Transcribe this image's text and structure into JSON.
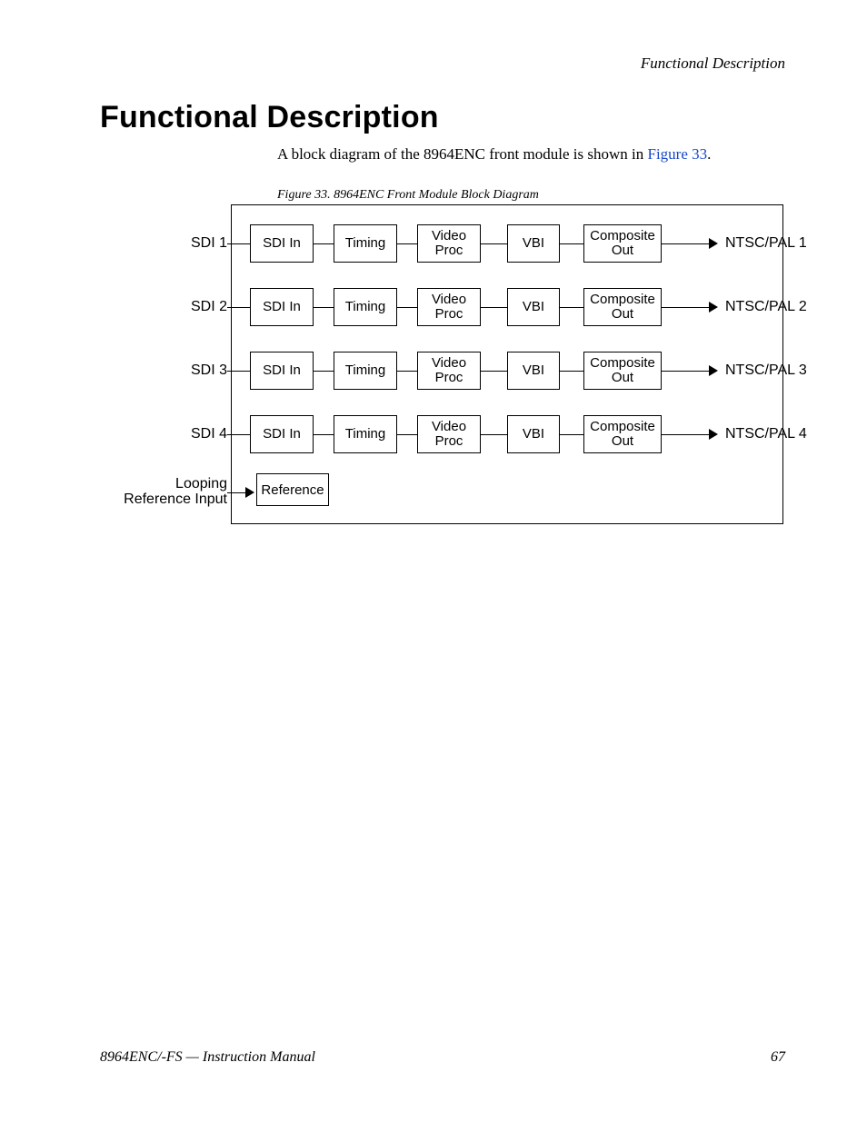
{
  "header": {
    "running": "Functional Description"
  },
  "title": "Functional Description",
  "intro": {
    "text_before": "A block diagram of the 8964ENC front module is shown in ",
    "figref": "Figure 33",
    "text_after": "."
  },
  "figure": {
    "caption": "Figure 33.  8964ENC Front Module Block Diagram"
  },
  "diagram": {
    "rows": [
      {
        "in": "SDI 1",
        "out": "NTSC/PAL 1"
      },
      {
        "in": "SDI 2",
        "out": "NTSC/PAL 2"
      },
      {
        "in": "SDI 3",
        "out": "NTSC/PAL 3"
      },
      {
        "in": "SDI 4",
        "out": "NTSC/PAL 4"
      }
    ],
    "blocks": {
      "sdi_in": "SDI In",
      "timing": "Timing",
      "video_proc_l1": "Video",
      "video_proc_l2": "Proc",
      "vbi": "VBI",
      "comp_out_l1": "Composite",
      "comp_out_l2": "Out"
    },
    "reference": {
      "label_l1": "Looping",
      "label_l2": "Reference Input",
      "box": "Reference"
    }
  },
  "footer": {
    "left": "8964ENC/-FS — Instruction Manual",
    "right": "67"
  }
}
